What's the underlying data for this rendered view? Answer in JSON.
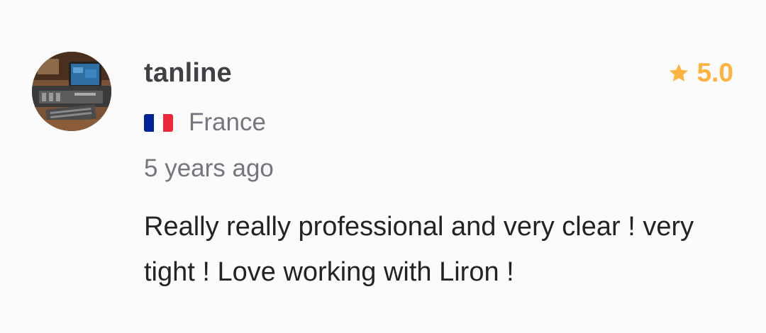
{
  "review": {
    "username": "tanline",
    "rating": "5.0",
    "country": "France",
    "time_ago": "5 years ago",
    "text": "Really really professional and very clear ! very tight ! Love working with Liron !"
  },
  "icons": {
    "star": "star-icon",
    "flag": "france-flag-icon"
  },
  "colors": {
    "rating": "#ffb33e",
    "username": "#404145",
    "muted": "#74767e",
    "body_text": "#222325",
    "flag_blue": "#002395",
    "flag_white": "#ffffff",
    "flag_red": "#ed2939"
  }
}
